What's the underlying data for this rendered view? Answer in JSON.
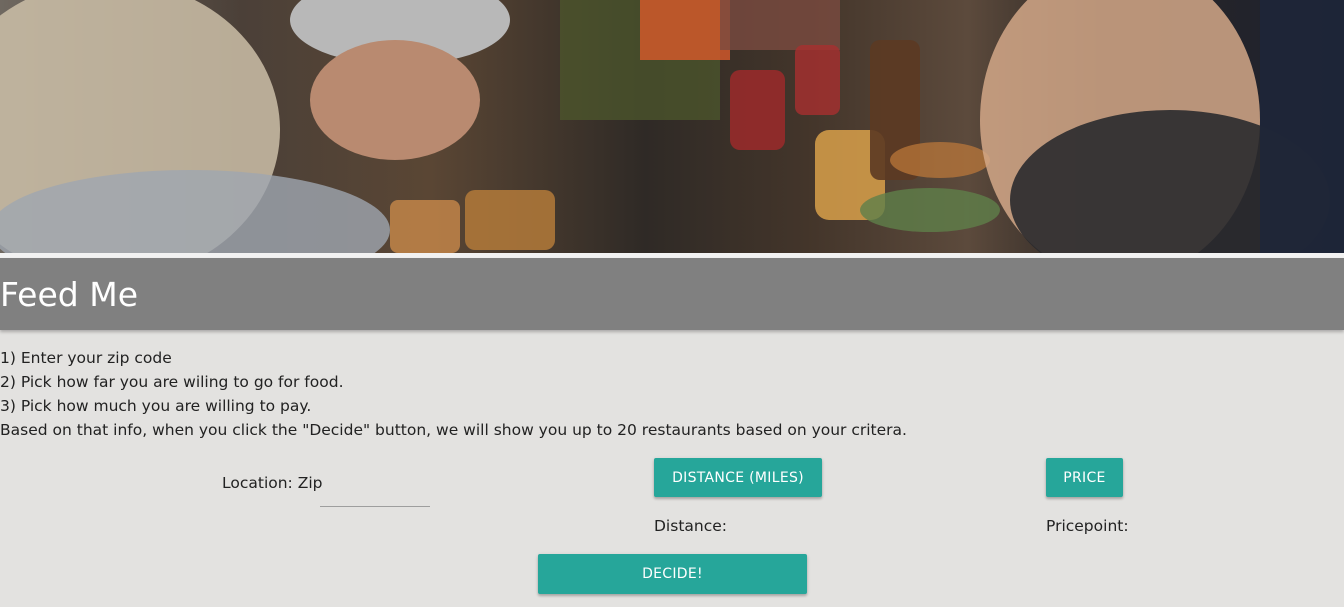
{
  "hero": {
    "description_icon": "restaurant-dining-photo"
  },
  "header": {
    "title": "Feed Me"
  },
  "instructions": {
    "line1": "1) Enter your zip code",
    "line2": "2) Pick how far you are wiling to go for food.",
    "line3": "3) Pick how much you are willing to pay.",
    "line4": "Based on that info, when you click the \"Decide\" button, we will show you up to 20 restaurants based on your critera."
  },
  "form": {
    "location_label": "Location: Zip",
    "zip_value": "",
    "zip_placeholder": "",
    "distance_button": "DISTANCE (MILES)",
    "distance_label": "Distance:",
    "price_button": "PRICE",
    "price_label": "Pricepoint:",
    "decide_button": "DECIDE!"
  },
  "colors": {
    "accent": "#26a69a",
    "banner": "#808080",
    "background": "#e3e2e0"
  }
}
